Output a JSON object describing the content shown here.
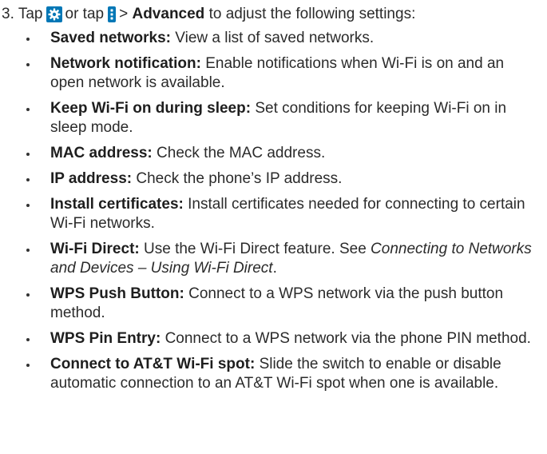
{
  "step": {
    "number": "3.",
    "tap_before": "Tap",
    "or_tap": "or tap",
    "gt": ">",
    "advanced": "Advanced",
    "suffix": "to adjust the following settings:",
    "icons": [
      "gear-icon",
      "menu-dots-icon"
    ],
    "icon_color": "#0077b6"
  },
  "items": [
    {
      "term": "Saved networks:",
      "desc": "View a list of saved networks."
    },
    {
      "term": "Network notification:",
      "desc": "Enable notifications when Wi-Fi is on and an open network is available."
    },
    {
      "term": "Keep Wi-Fi on during sleep:",
      "desc": "Set conditions for keeping Wi-Fi on in sleep mode."
    },
    {
      "term": "MAC address:",
      "desc": "Check the MAC address."
    },
    {
      "term": "IP address:",
      "desc": "Check the phone’s IP address."
    },
    {
      "term": "Install certificates:",
      "desc": "Install certificates needed for connecting to certain Wi-Fi networks."
    },
    {
      "term": "Wi-Fi Direct:",
      "desc": "Use the Wi-Fi Direct feature. See",
      "ref": "Connecting to Networks and Devices – Using Wi-Fi Direct",
      "end": "."
    },
    {
      "term": "WPS Push Button:",
      "desc": "Connect to a WPS network via the push button method."
    },
    {
      "term": "WPS Pin Entry:",
      "desc": "Connect to a WPS network via the phone PIN method."
    },
    {
      "term": "Connect to AT&T Wi-Fi spot:",
      "desc": "Slide the switch to enable or disable automatic connection to an AT&T Wi-Fi spot when one is available."
    }
  ]
}
